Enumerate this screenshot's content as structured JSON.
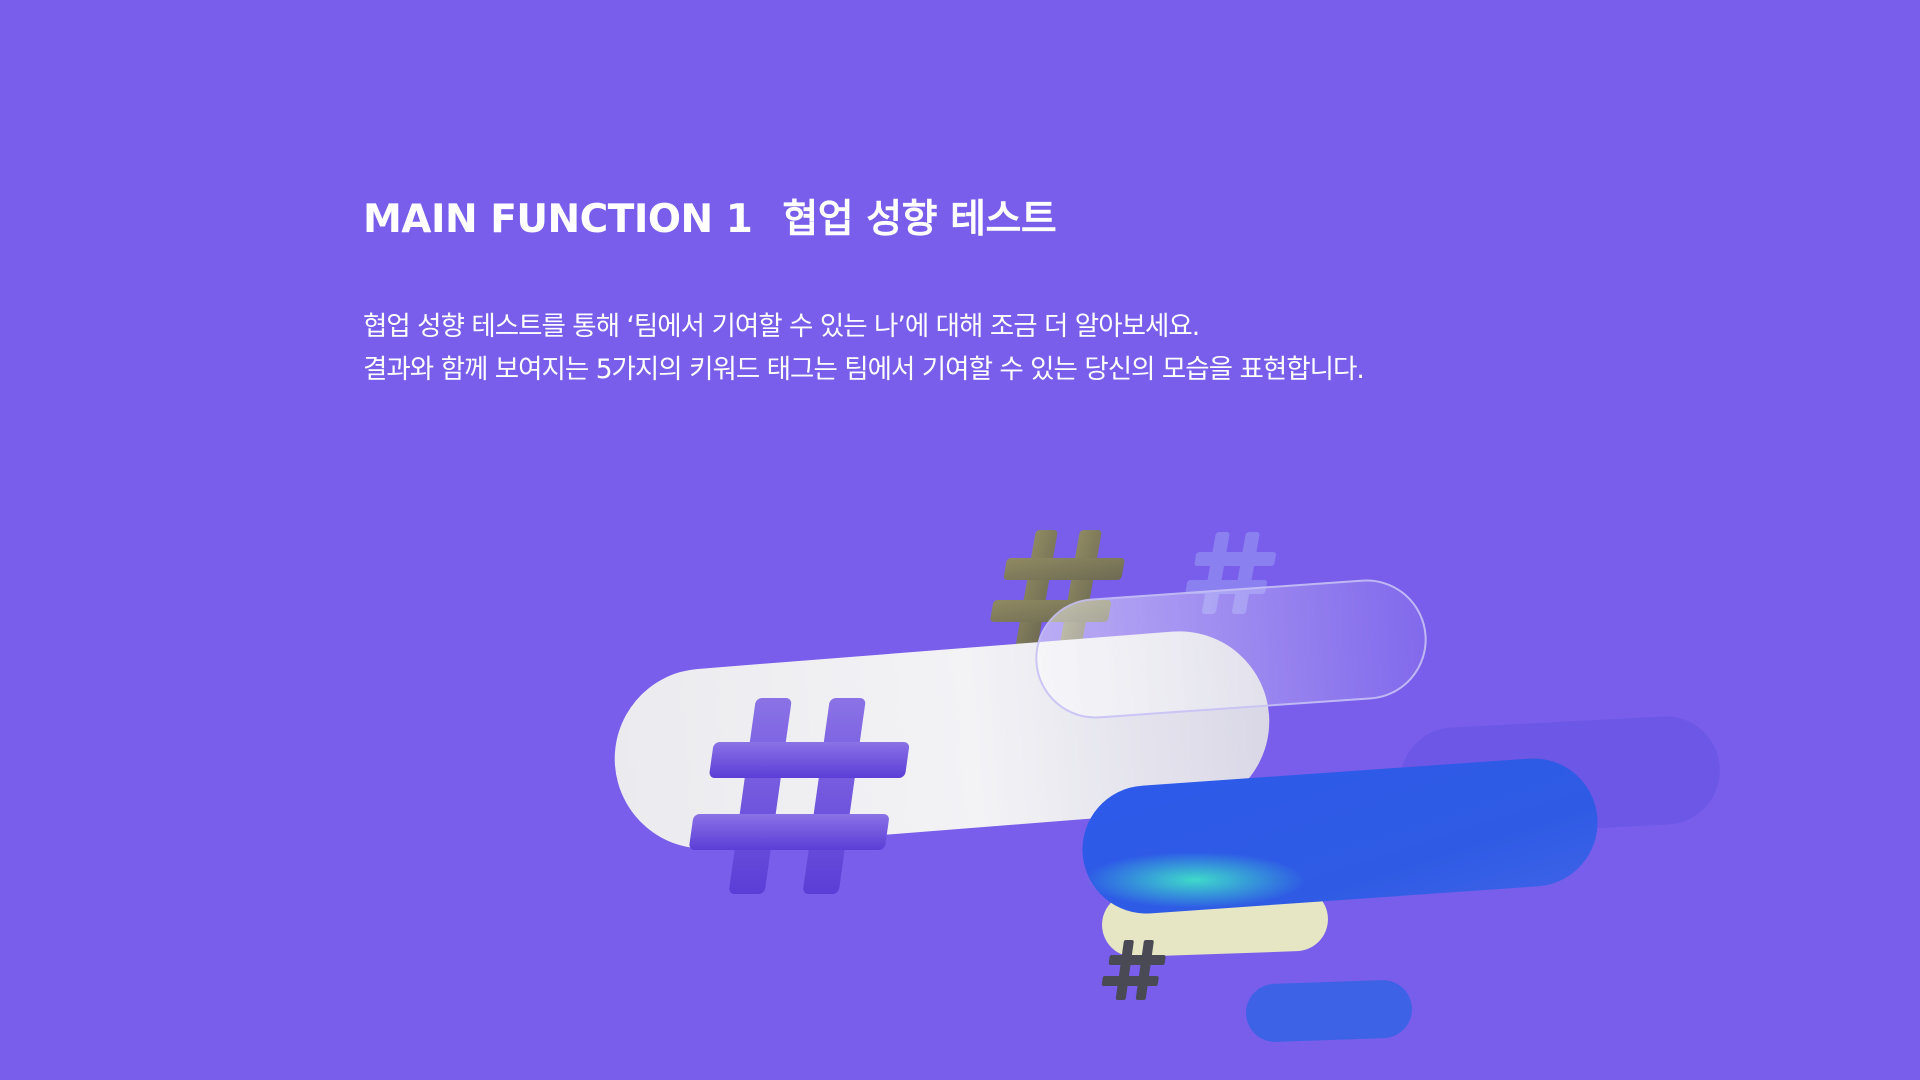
{
  "heading": {
    "eyebrow": "MAIN FUNCTION 1",
    "title": "협업 성향 테스트"
  },
  "description": {
    "line1": "협업 성향 테스트를 통해 ‘팀에서 기여할 수 있는 나’에 대해 조금 더 알아보세요.",
    "line2": "결과와 함께 보여지는 5가지의 키워드 태그는 팀에서 기여할 수 있는 당신의 모습을 표현합니다."
  },
  "illustration": {
    "icons": [
      "hashtag-icon"
    ],
    "colors": {
      "background": "#785EEA",
      "white_pill": "#EEEEF2",
      "blue_pill": "#2F5BE6",
      "cream_pill": "#E6E6C4",
      "violet_hash": "#6A4FD8",
      "olive_hash": "#7C7A5E",
      "gray_hash": "#4A4A55"
    }
  }
}
